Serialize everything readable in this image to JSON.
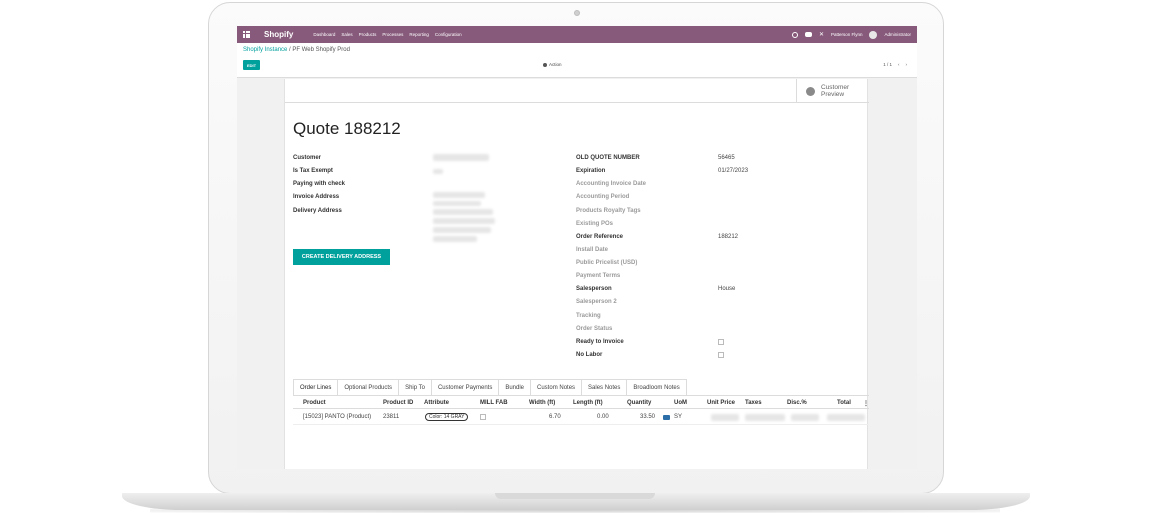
{
  "topbar": {
    "brand": "Shopify",
    "menu": [
      "Dashboard",
      "Sales",
      "Products",
      "Processes",
      "Reporting",
      "Configuration"
    ],
    "user": "Patterson Flynn",
    "admin": "Administrator"
  },
  "control": {
    "breadcrumb_link": "Shopify Instance",
    "breadcrumb_sep": "/",
    "breadcrumb_current": "PF Web Shopify Prod",
    "edit_label": "EDIT",
    "action_label": "Action",
    "pager_text": "1 / 1",
    "pager_prev": "‹",
    "pager_next": "›"
  },
  "form": {
    "preview_label": "Customer Preview",
    "title": "Quote 188212",
    "left_labels": [
      "Customer",
      "Is Tax Exempt",
      "Paying with check",
      "Invoice Address",
      "Delivery Address"
    ],
    "create_delivery_label": "CREATE DELIVERY ADDRESS",
    "right_fields": [
      {
        "label": "OLD QUOTE NUMBER",
        "value": "56465"
      },
      {
        "label": "Expiration",
        "value": "01/27/2023"
      },
      {
        "label": "Accounting Invoice Date",
        "value": ""
      },
      {
        "label": "Accounting Period",
        "value": ""
      },
      {
        "label": "Products Royalty Tags",
        "value": ""
      },
      {
        "label": "Existing POs",
        "value": ""
      },
      {
        "label": "Order Reference",
        "value": "188212"
      },
      {
        "label": "Install Date",
        "value": ""
      },
      {
        "label": "Public Pricelist (USD)",
        "value": ""
      },
      {
        "label": "Payment Terms",
        "value": ""
      },
      {
        "label": "Salesperson",
        "value": "House"
      },
      {
        "label": "Salesperson 2",
        "value": ""
      },
      {
        "label": "Tracking",
        "value": ""
      },
      {
        "label": "Order Status",
        "value": ""
      },
      {
        "label": "Ready to Invoice",
        "value": ""
      },
      {
        "label": "No Labor",
        "value": ""
      }
    ]
  },
  "tabs": [
    "Order Lines",
    "Optional Products",
    "Ship To",
    "Customer Payments",
    "Bundle",
    "Custom Notes",
    "Sales Notes",
    "Broadloom Notes"
  ],
  "order_lines": {
    "columns": [
      "Product",
      "Product ID",
      "Attribute",
      "MILL FAB",
      "Width (ft)",
      "Length (ft)",
      "Quantity",
      "UoM",
      "Unit Price",
      "Taxes",
      "Disc.%",
      "Total"
    ],
    "rows": [
      {
        "product": "[15023] PANTO (Product)",
        "product_id": "23811",
        "attribute": "Color: 14 GRAY",
        "width": "6.70",
        "length": "0.00",
        "quantity": "33.50",
        "uom": "SY"
      }
    ]
  },
  "colors": {
    "brand": "#875a7b",
    "primary": "#00a09d"
  }
}
